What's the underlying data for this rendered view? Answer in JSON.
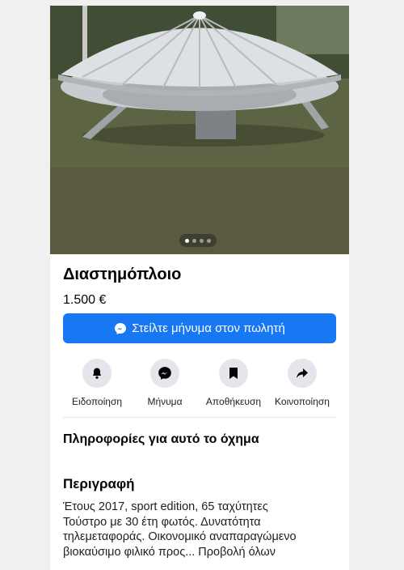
{
  "listing": {
    "title": "Διαστημόπλοιο",
    "price": "1.500 €",
    "image_alt": "flying-saucer-photo",
    "carousel": {
      "total": 4,
      "active_index": 0
    }
  },
  "message_button": {
    "label": "Στείλτε μήνυμα στον πωλητή",
    "icon": "messenger-icon"
  },
  "actions": [
    {
      "label": "Ειδοποίηση",
      "icon": "bell-icon"
    },
    {
      "label": "Μήνυμα",
      "icon": "messenger-icon"
    },
    {
      "label": "Αποθήκευση",
      "icon": "bookmark-icon"
    },
    {
      "label": "Κοινοποίηση",
      "icon": "share-icon"
    }
  ],
  "details": {
    "section_title": "Πληροφορίες για αυτό το όχημα"
  },
  "description": {
    "title": "Περιγραφή",
    "lines": [
      "Έτους 2017, sport edition, 65 ταχύτητες",
      "Τούστρο με 30 έτη φωτός. Δυνατότητα",
      "τηλεμεταφοράς. Οικονομικό αναπαραγώμενο",
      "βιοκαύσιμο φιλικό προς... Προβολή όλων"
    ]
  },
  "colors": {
    "accent": "#1877f2",
    "icon_bg": "#e4e6eb"
  }
}
